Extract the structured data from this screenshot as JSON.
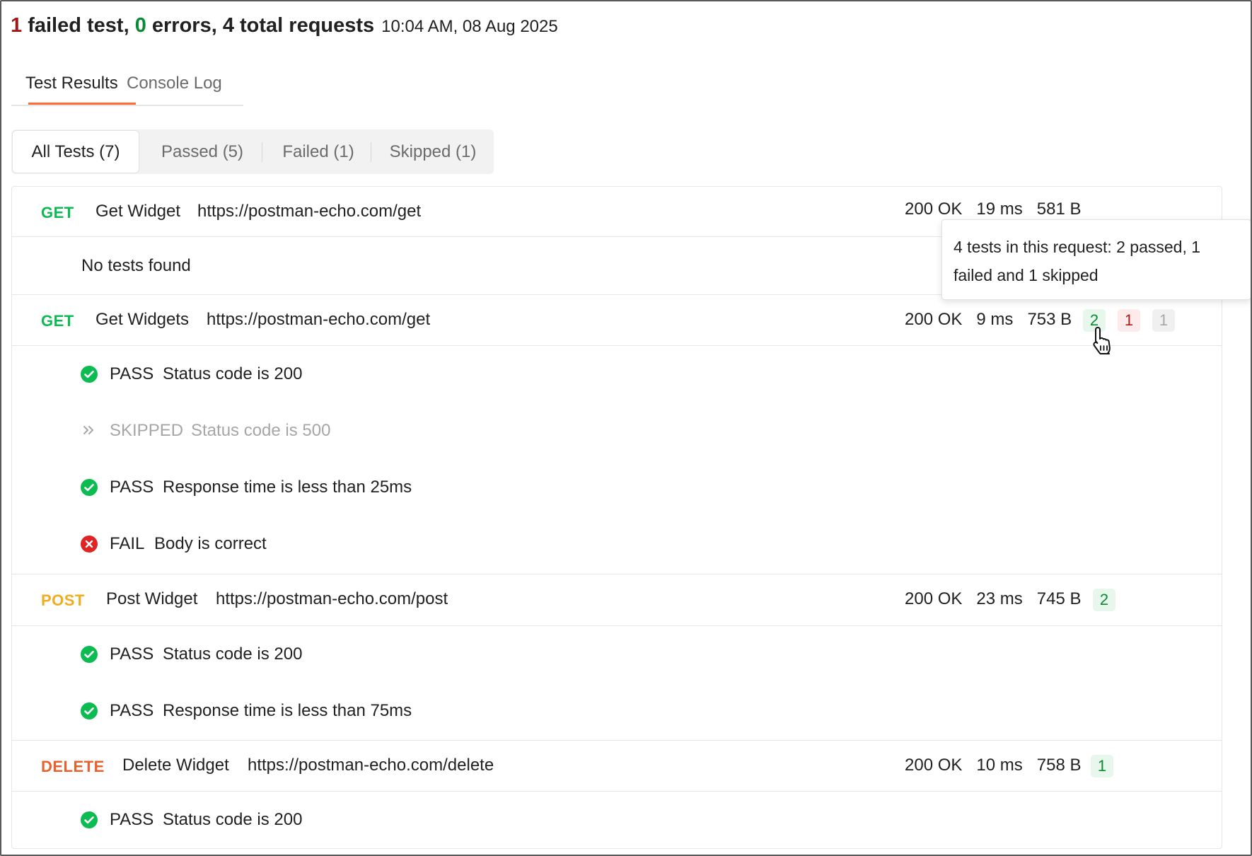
{
  "summary": {
    "failed_count": "1",
    "failed_text": " failed test, ",
    "errors_count": "0",
    "errors_text": " errors, 4 total requests",
    "timestamp": "10:04 AM, 08 Aug 2025"
  },
  "tabs": [
    {
      "label": "Test Results",
      "active": true
    },
    {
      "label": "Console Log",
      "active": false
    }
  ],
  "filters": [
    {
      "label": "All Tests (7)",
      "active": true
    },
    {
      "label": "Passed (5)",
      "active": false
    },
    {
      "label": "Failed (1)",
      "active": false
    },
    {
      "label": "Skipped (1)",
      "active": false
    }
  ],
  "requests": [
    {
      "method": "GET",
      "name": "Get Widget",
      "url": "https://postman-echo.com/get",
      "status": "200 OK",
      "time": "19 ms",
      "size": "581 B",
      "no_tests": "No tests found"
    },
    {
      "method": "GET",
      "name": "Get Widgets",
      "url": "https://postman-echo.com/get",
      "status": "200 OK",
      "time": "9 ms",
      "size": "753 B",
      "badges": {
        "passed": "2",
        "failed": "1",
        "skipped": "1"
      },
      "tests": [
        {
          "status": "PASS",
          "name": "Status code is 200"
        },
        {
          "status": "SKIPPED",
          "name": "Status code is 500"
        },
        {
          "status": "PASS",
          "name": "Response time is less than 25ms"
        },
        {
          "status": "FAIL",
          "name": "Body is correct"
        }
      ]
    },
    {
      "method": "POST",
      "name": "Post Widget",
      "url": "https://postman-echo.com/post",
      "status": "200 OK",
      "time": "23 ms",
      "size": "745 B",
      "badges": {
        "passed": "2"
      },
      "tests": [
        {
          "status": "PASS",
          "name": "Status code is 200"
        },
        {
          "status": "PASS",
          "name": "Response time is less than 75ms"
        }
      ]
    },
    {
      "method": "DELETE",
      "name": "Delete Widget",
      "url": "https://postman-echo.com/delete",
      "status": "200 OK",
      "time": "10 ms",
      "size": "758 B",
      "badges": {
        "passed": "1"
      },
      "tests": [
        {
          "status": "PASS",
          "name": "Status code is 200"
        }
      ]
    }
  ],
  "tooltip": {
    "text": "4 tests in this request: 2 passed, 1 failed and 1 skipped"
  },
  "colors": {
    "accent": "#ff6c37",
    "get": "#0cbb52",
    "post": "#f2ad1f",
    "delete": "#eb5f2c",
    "pass": "#0cbb52",
    "fail": "#e02424",
    "skip": "#a6a6a6"
  },
  "icons": {
    "pass": "check-circle-icon",
    "fail": "x-circle-icon",
    "skip": "double-chevron-right-icon",
    "cursor": "hand-pointer-cursor-icon"
  }
}
